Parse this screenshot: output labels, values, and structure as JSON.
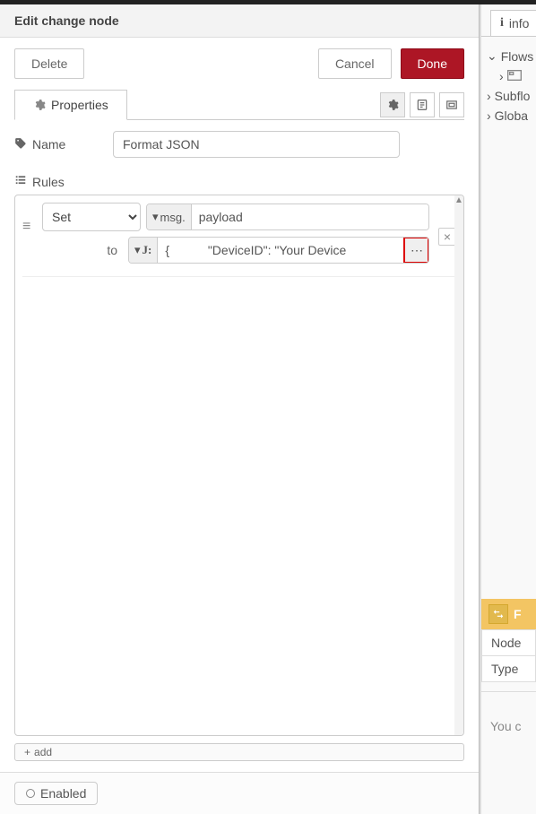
{
  "header": {
    "title": "Edit change node"
  },
  "buttons": {
    "delete": "Delete",
    "cancel": "Cancel",
    "done": "Done"
  },
  "tabs": {
    "properties": "Properties"
  },
  "form": {
    "name_label": "Name",
    "name_value": "Format JSON",
    "rules_label": "Rules"
  },
  "rule": {
    "set_label": "Set",
    "msg_label": "msg.",
    "prop_value": "payload",
    "to_label": "to",
    "json_value": "{           \"DeviceID\": \"Your Device"
  },
  "add_label": "add",
  "footer": {
    "enabled": "Enabled"
  },
  "side": {
    "info_tab": "info",
    "tree": {
      "flows": "Flows",
      "subfl": "Subflo",
      "globa": "Globa"
    },
    "panel_rows": {
      "node": "Node",
      "type": "Type",
      "f_label": "F"
    },
    "hint": "You c"
  }
}
